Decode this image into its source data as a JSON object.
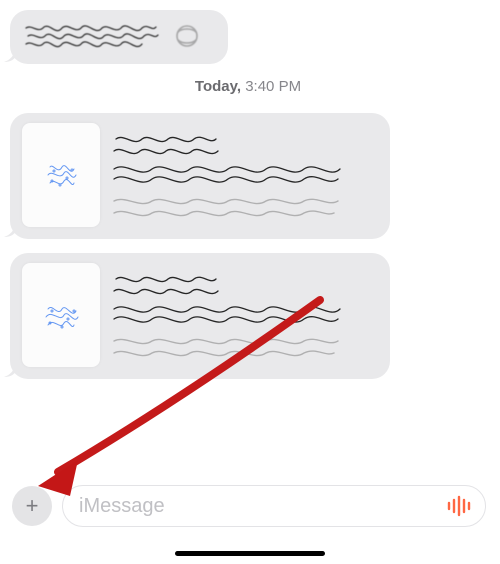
{
  "timestamp": {
    "day_label": "Today,",
    "time_label": "3:40 PM"
  },
  "compose": {
    "placeholder": "iMessage"
  },
  "icons": {
    "plus": "+"
  },
  "colors": {
    "bubble_bg": "#e9e9eb",
    "arrow": "#c61818",
    "voice": "#ff6743"
  }
}
